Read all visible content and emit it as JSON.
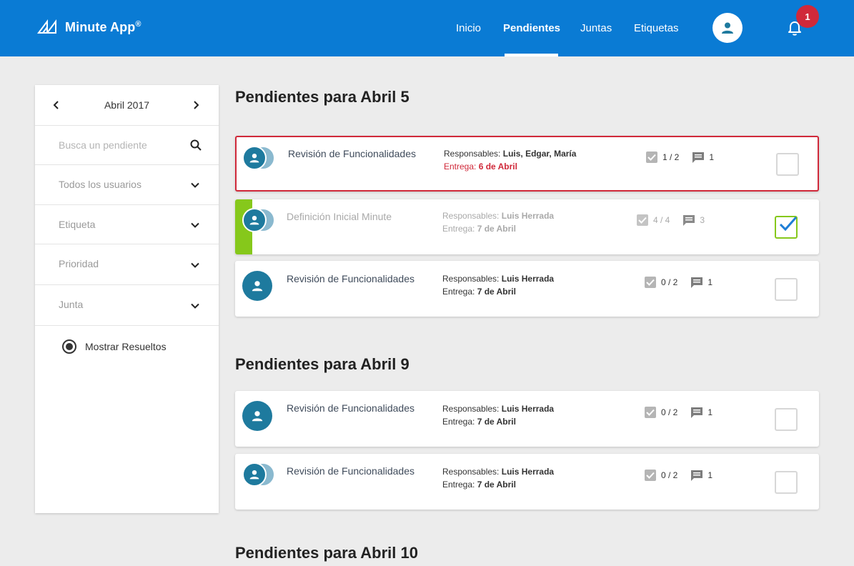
{
  "header": {
    "brand_name": "Minute App",
    "brand_mark": "®",
    "nav": [
      {
        "label": "Inicio"
      },
      {
        "label": "Pendientes"
      },
      {
        "label": "Juntas"
      },
      {
        "label": "Etiquetas"
      }
    ],
    "active_nav": "Pendientes",
    "notification_count": "1"
  },
  "sidebar": {
    "month_label": "Abril 2017",
    "search_placeholder": "Busca un pendiente",
    "filters": [
      {
        "label": "Todos los usuarios"
      },
      {
        "label": "Etiqueta"
      },
      {
        "label": "Prioridad"
      },
      {
        "label": "Junta"
      }
    ],
    "toggle_label": "Mostrar Resueltos"
  },
  "sections": [
    {
      "prefix": "Pendientes para",
      "date": "Abril 5",
      "tasks": [
        {
          "title": "Revisión de Funcionalidades",
          "resp_label": "Responsables:",
          "resp": "Luis, Edgar, María",
          "due_label": "Entrega:",
          "due": "6 de Abril",
          "checks": "1 / 2",
          "comments": "1",
          "overdue": true,
          "done": false
        },
        {
          "title": "Definición Inicial Minute",
          "resp_label": "Responsables:",
          "resp": "Luis Herrada",
          "due_label": "Entrega:",
          "due": "7 de Abril",
          "checks": "4 / 4",
          "comments": "3",
          "overdue": false,
          "done": true
        },
        {
          "title": "Revisión de Funcionalidades",
          "resp_label": "Responsables:",
          "resp": "Luis Herrada",
          "due_label": "Entrega:",
          "due": "7 de Abril",
          "checks": "0 / 2",
          "comments": "1",
          "overdue": false,
          "done": false
        }
      ]
    },
    {
      "prefix": "Pendientes para",
      "date": "Abril 9",
      "tasks": [
        {
          "title": "Revisión de Funcionalidades",
          "resp_label": "Responsables:",
          "resp": "Luis Herrada",
          "due_label": "Entrega:",
          "due": "7 de Abril",
          "checks": "0 / 2",
          "comments": "1",
          "overdue": false,
          "done": false
        },
        {
          "title": "Revisión de Funcionalidades",
          "resp_label": "Responsables:",
          "resp": "Luis Herrada",
          "due_label": "Entrega:",
          "due": "7 de Abril",
          "checks": "0 / 2",
          "comments": "1",
          "overdue": false,
          "done": false
        }
      ]
    },
    {
      "prefix": "Pendientes para",
      "date": "Abril 10",
      "tasks": []
    }
  ],
  "colors": {
    "brand_blue": "#0a7bd4",
    "overdue_red": "#d0293a",
    "done_green": "#86c81b",
    "avatar_teal": "#1e7a9e"
  },
  "icons": {
    "logo": "minute-logo-icon",
    "user": "user-icon",
    "bell": "bell-icon",
    "search": "search-icon",
    "chevron": "chevron-down-icon",
    "checklist": "checkbox-icon",
    "comment": "comment-icon"
  }
}
